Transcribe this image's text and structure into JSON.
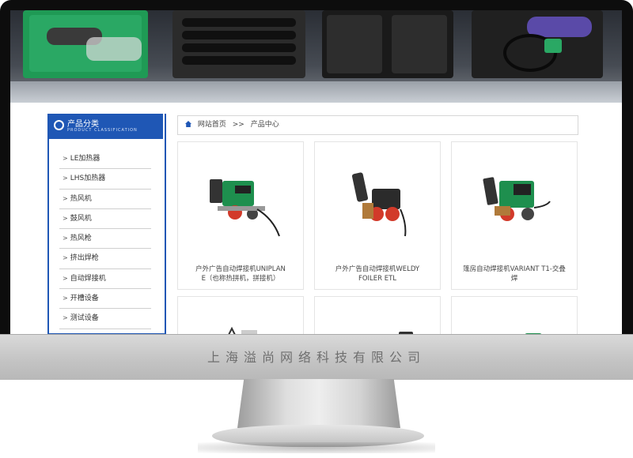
{
  "sidebar": {
    "title": "产品分类",
    "subtitle": "PRODUCT CLASSIFICATION",
    "items": [
      {
        "label": "LE加热器"
      },
      {
        "label": "LHS加热器"
      },
      {
        "label": "热风机"
      },
      {
        "label": "鼓风机"
      },
      {
        "label": "热风枪"
      },
      {
        "label": "挤出焊枪"
      },
      {
        "label": "自动焊接机"
      },
      {
        "label": "开槽设备"
      },
      {
        "label": "测试设备"
      }
    ]
  },
  "breadcrumb": {
    "home": "网站首页",
    "separator": ">>",
    "current": "产品中心"
  },
  "products": [
    {
      "name_line1": "户外广告自动焊接机UNIPLAN",
      "name_line2": "E（也称热拼机，拼接机）"
    },
    {
      "name_line1": "户外广告自动焊接机WELDY",
      "name_line2": "FOILER ETL"
    },
    {
      "name_line1": "篷房自动焊接机VARIANT T1-交叠",
      "name_line2": "焊"
    }
  ],
  "footer": {
    "company": "上海溢尚网络科技有限公司"
  },
  "colors": {
    "accent": "#1f57b5",
    "machine_green": "#1e8f4e",
    "machine_red": "#d23a2a"
  }
}
